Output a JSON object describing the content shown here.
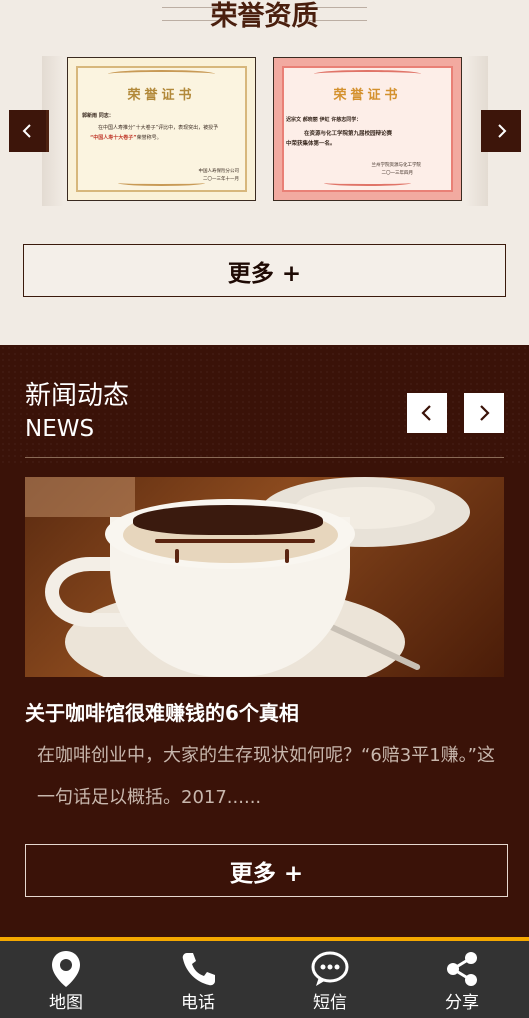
{
  "honors": {
    "title": "荣誉资质",
    "more_label": "更多 +",
    "cert1": {
      "title": "荣誉证书",
      "recipient": "郭新雨",
      "greeting": "同志：",
      "line1": "在中国人寿推分“十大卷子”评比中，表现突出，被授予",
      "award": "“中国人寿十大卷子”",
      "line2": "荣誉称号。",
      "issuer": "中国人寿保险分公司",
      "date": "二〇一三年十一月"
    },
    "cert2": {
      "title": "荣誉证书",
      "line1": "迟宗文 郝晓丽 伊虹 许慈志同学：",
      "line2": "在资源与化工学院第九届校园辩论赛",
      "line3": "中荣获集体第一名。",
      "issuer": "兰州学院资源与化工学院",
      "date": "二〇一三年四月"
    }
  },
  "news": {
    "title_cn": "新闻动态",
    "title_en": "NEWS",
    "headline": "关于咖啡馆很难赚钱的6个真相",
    "summary": "在咖啡创业中，大家的生存现状如何呢？“6赔3平1赚。”这一句话足以概括。2017......",
    "more_label": "更多 +"
  },
  "bottom_nav": {
    "map": "地图",
    "phone": "电话",
    "sms": "短信",
    "share": "分享"
  },
  "colors": {
    "brown_dark": "#3a1208",
    "title_brown": "#4a1f0e",
    "accent_yellow": "#f5a800",
    "bar_gray": "#333333"
  }
}
